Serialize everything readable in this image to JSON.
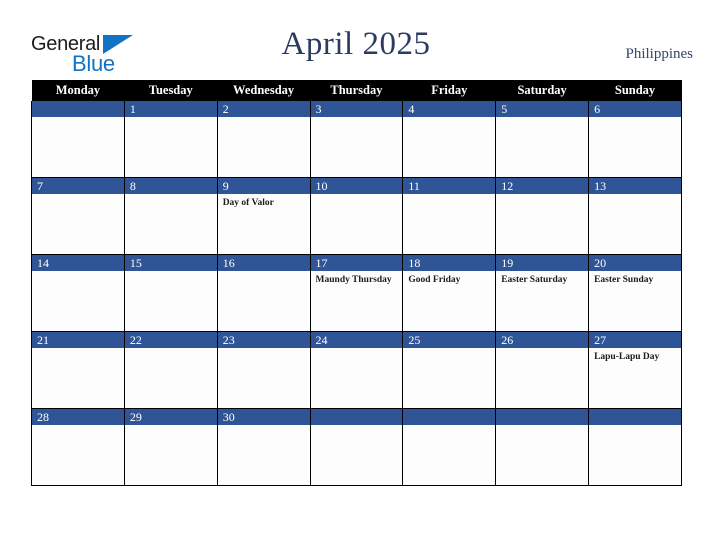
{
  "brand": {
    "name_top": "General",
    "name_bottom": "Blue",
    "flag_color": "#1273c4",
    "top_color": "#1c1c1c"
  },
  "header": {
    "title": "April 2025",
    "country": "Philippines",
    "title_color": "#2b3c61",
    "country_color": "#35456a"
  },
  "calendar": {
    "weekday_headers": [
      "Monday",
      "Tuesday",
      "Wednesday",
      "Thursday",
      "Friday",
      "Saturday",
      "Sunday"
    ],
    "header_bg": "#000000",
    "header_fg": "#ffffff",
    "daybar_bg": "#2f5596",
    "daybar_fg": "#ffffff",
    "cell_bg": "#fdfdfd",
    "grid_line": "#000000",
    "weeks": [
      [
        {
          "day": "",
          "event": ""
        },
        {
          "day": "1",
          "event": ""
        },
        {
          "day": "2",
          "event": ""
        },
        {
          "day": "3",
          "event": ""
        },
        {
          "day": "4",
          "event": ""
        },
        {
          "day": "5",
          "event": ""
        },
        {
          "day": "6",
          "event": ""
        }
      ],
      [
        {
          "day": "7",
          "event": ""
        },
        {
          "day": "8",
          "event": ""
        },
        {
          "day": "9",
          "event": "Day of Valor"
        },
        {
          "day": "10",
          "event": ""
        },
        {
          "day": "11",
          "event": ""
        },
        {
          "day": "12",
          "event": ""
        },
        {
          "day": "13",
          "event": ""
        }
      ],
      [
        {
          "day": "14",
          "event": ""
        },
        {
          "day": "15",
          "event": ""
        },
        {
          "day": "16",
          "event": ""
        },
        {
          "day": "17",
          "event": "Maundy Thursday"
        },
        {
          "day": "18",
          "event": "Good Friday"
        },
        {
          "day": "19",
          "event": "Easter Saturday"
        },
        {
          "day": "20",
          "event": "Easter Sunday"
        }
      ],
      [
        {
          "day": "21",
          "event": ""
        },
        {
          "day": "22",
          "event": ""
        },
        {
          "day": "23",
          "event": ""
        },
        {
          "day": "24",
          "event": ""
        },
        {
          "day": "25",
          "event": ""
        },
        {
          "day": "26",
          "event": ""
        },
        {
          "day": "27",
          "event": "Lapu-Lapu Day"
        }
      ],
      [
        {
          "day": "28",
          "event": ""
        },
        {
          "day": "29",
          "event": ""
        },
        {
          "day": "30",
          "event": ""
        },
        {
          "day": "",
          "event": ""
        },
        {
          "day": "",
          "event": ""
        },
        {
          "day": "",
          "event": ""
        },
        {
          "day": "",
          "event": ""
        }
      ]
    ]
  }
}
